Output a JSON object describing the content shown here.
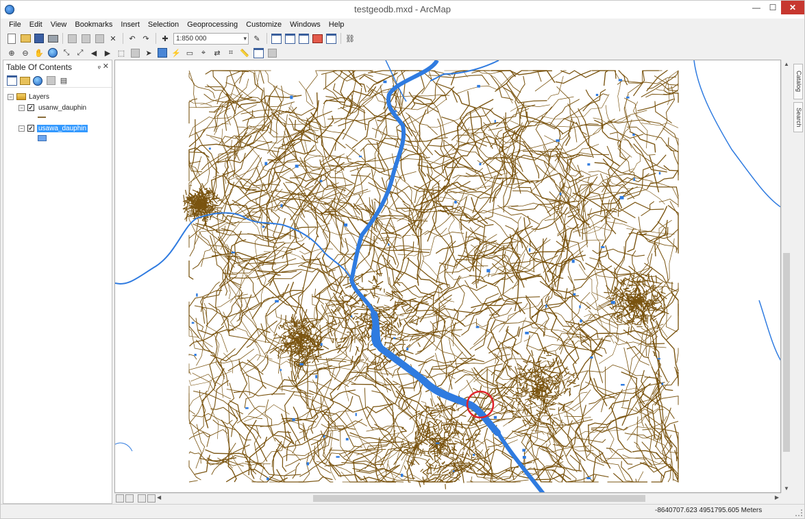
{
  "window": {
    "title": "testgeodb.mxd - ArcMap",
    "minimize_label": "—",
    "maximize_label": "☐",
    "close_label": "✕"
  },
  "menu": [
    "File",
    "Edit",
    "View",
    "Bookmarks",
    "Insert",
    "Selection",
    "Geoprocessing",
    "Customize",
    "Windows",
    "Help"
  ],
  "toolbar": {
    "scale_value": "1:850 000",
    "scale_dropdown_icon": "chevron-down-icon"
  },
  "toc": {
    "title": "Table Of Contents",
    "pin_label": "ᵩ",
    "close_label": "✕",
    "root_label": "Layers",
    "layers": [
      {
        "name": "usanw_dauphin",
        "checked_mark": "✓",
        "expander": "−",
        "legend": "line",
        "color": "#8a6d3b"
      },
      {
        "name": "usawa_dauphin",
        "checked_mark": "✓",
        "expander": "−",
        "legend": "polygon",
        "color": "#6ea6ef"
      }
    ]
  },
  "dock_tabs": [
    "Catalog",
    "Search"
  ],
  "map": {
    "road_color": "#7a5410",
    "water_color": "#2f7be0",
    "highlight_color": "#e0242a"
  },
  "status": {
    "coordinates": "-8640707.623  4951795.605 Meters"
  }
}
